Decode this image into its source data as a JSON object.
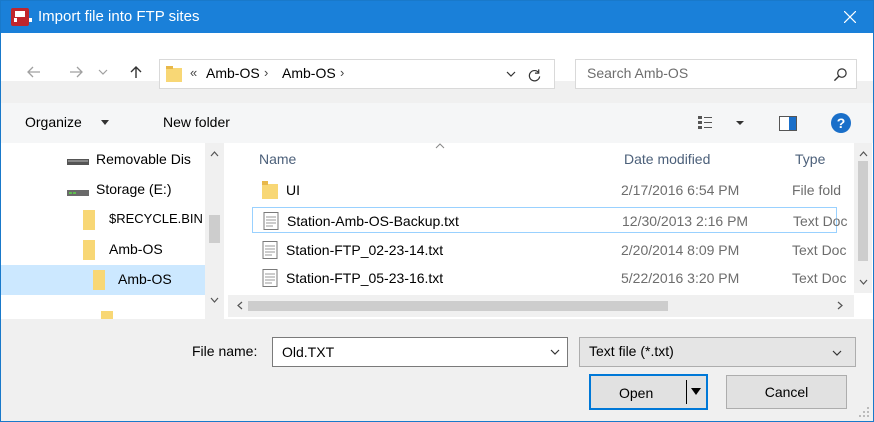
{
  "window": {
    "title": "Import file into FTP sites",
    "close_icon": "close-icon"
  },
  "nav": {
    "back_icon": "arrow-left-icon",
    "forward_icon": "arrow-right-icon",
    "recent_icon": "chevron-down-icon",
    "up_icon": "arrow-up-icon",
    "breadcrumb_overflow": "«",
    "breadcrumb": [
      "Amb-OS",
      "Amb-OS"
    ],
    "separator": "›",
    "refresh_icon": "refresh-icon",
    "search_placeholder": "Search Amb-OS"
  },
  "toolbar": {
    "organize_label": "Organize",
    "new_folder_label": "New folder",
    "help_label": "?"
  },
  "tree": {
    "items": [
      {
        "label": "Removable Dis",
        "icon": "drive-icon",
        "selected": false
      },
      {
        "label": "Storage (E:)",
        "icon": "drive-icon",
        "selected": false
      },
      {
        "label": "$RECYCLE.BIN",
        "icon": "folder-icon",
        "selected": false
      },
      {
        "label": "Amb-OS",
        "icon": "folder-icon",
        "selected": false
      },
      {
        "label": "Amb-OS",
        "icon": "folder-icon",
        "selected": true
      }
    ]
  },
  "files": {
    "columns": {
      "name": "Name",
      "date": "Date modified",
      "type": "Type"
    },
    "rows": [
      {
        "name": "UI",
        "date": "2/17/2016 6:54 PM",
        "type": "File fold",
        "icon": "folder-icon"
      },
      {
        "name": "Station-Amb-OS-Backup.txt",
        "date": "12/30/2013 2:16 PM",
        "type": "Text Doc",
        "icon": "text-file-icon"
      },
      {
        "name": "Station-FTP_02-23-14.txt",
        "date": "2/20/2014 8:09 PM",
        "type": "Text Doc",
        "icon": "text-file-icon"
      },
      {
        "name": "Station-FTP_05-23-16.txt",
        "date": "5/22/2016 3:20 PM",
        "type": "Text Doc",
        "icon": "text-file-icon"
      }
    ]
  },
  "bottom": {
    "filename_label": "File name:",
    "filename_value": "Old.TXT",
    "filetype_value": "Text file (*.txt)",
    "open_label": "Open",
    "cancel_label": "Cancel"
  },
  "colors": {
    "titlebar": "#1a80d9",
    "selection": "#cce8ff",
    "focus_border": "#0078d7"
  }
}
